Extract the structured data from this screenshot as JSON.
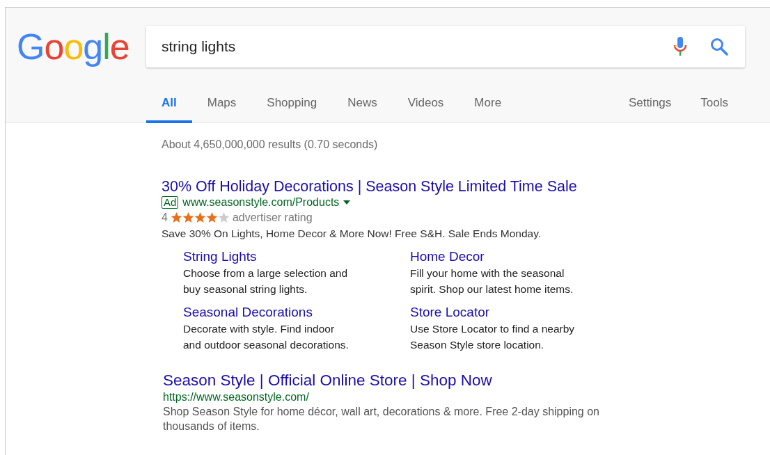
{
  "logo": {
    "text": "Google"
  },
  "search": {
    "value": "string lights"
  },
  "tabs": [
    {
      "label": "All",
      "selected": true
    },
    {
      "label": "Maps",
      "selected": false
    },
    {
      "label": "Shopping",
      "selected": false
    },
    {
      "label": "News",
      "selected": false
    },
    {
      "label": "Videos",
      "selected": false
    },
    {
      "label": "More",
      "selected": false
    }
  ],
  "tools": [
    "Settings",
    "Tools"
  ],
  "result_stats": "About 4,650,000,000 results (0.70 seconds)",
  "ad": {
    "title": "30% Off Holiday Decorations | Season Style Limited Time Sale",
    "badge": "Ad",
    "url": "www.seasonstyle.com/Products",
    "rating": "4",
    "stars": 4,
    "rating_label": "advertiser rating",
    "description": "Save 30% On Lights, Home Decor & More Now! Free S&H. Sale Ends Monday.",
    "sitelinks": [
      {
        "title": "String Lights",
        "lines": [
          "Choose from a large selection and",
          "buy seasonal string lights."
        ]
      },
      {
        "title": "Home Decor",
        "lines": [
          "Fill your home with the seasonal",
          "spirit. Shop our latest home items."
        ]
      },
      {
        "title": "Seasonal Decorations",
        "lines": [
          "Decorate with style. Find indoor",
          "and outdoor seasonal decorations."
        ]
      },
      {
        "title": "Store Locator",
        "lines": [
          "Use Store Locator to find a nearby",
          "Season Style store location."
        ]
      }
    ]
  },
  "result": {
    "title": "Season Style | Official Online Store | Shop Now",
    "url": "https://www.seasonstyle.com/",
    "snippet": "Shop Season Style for home décor, wall art, decorations & more. Free 2-day shipping on thousands of items."
  }
}
